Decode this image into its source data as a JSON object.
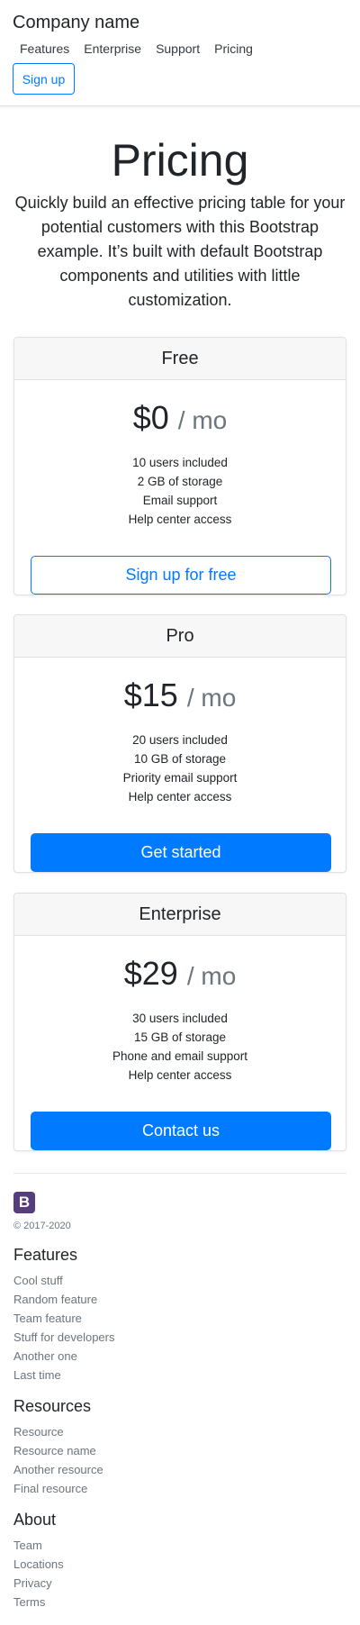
{
  "header": {
    "brand": "Company name",
    "nav": [
      "Features",
      "Enterprise",
      "Support",
      "Pricing"
    ],
    "signup_label": "Sign up"
  },
  "hero": {
    "title": "Pricing",
    "lead": "Quickly build an effective pricing table for your potential customers with this Bootstrap example. It’s built with default Bootstrap components and utilities with little customization."
  },
  "plans": [
    {
      "name": "Free",
      "price": "$0",
      "period": "/ mo",
      "features": [
        "10 users included",
        "2 GB of storage",
        "Email support",
        "Help center access"
      ],
      "button": "Sign up for free"
    },
    {
      "name": "Pro",
      "price": "$15",
      "period": "/ mo",
      "features": [
        "20 users included",
        "10 GB of storage",
        "Priority email support",
        "Help center access"
      ],
      "button": "Get started"
    },
    {
      "name": "Enterprise",
      "price": "$29",
      "period": "/ mo",
      "features": [
        "30 users included",
        "15 GB of storage",
        "Phone and email support",
        "Help center access"
      ],
      "button": "Contact us"
    }
  ],
  "footer": {
    "logo_letter": "B",
    "copyright": "© 2017-2020",
    "sections": [
      {
        "title": "Features",
        "links": [
          "Cool stuff",
          "Random feature",
          "Team feature",
          "Stuff for developers",
          "Another one",
          "Last time"
        ]
      },
      {
        "title": "Resources",
        "links": [
          "Resource",
          "Resource name",
          "Another resource",
          "Final resource"
        ]
      },
      {
        "title": "About",
        "links": [
          "Team",
          "Locations",
          "Privacy",
          "Terms"
        ]
      }
    ]
  },
  "colors": {
    "primary": "#007bff",
    "text": "#212529",
    "muted": "#6c757d",
    "card_header_bg": "#f7f7f7",
    "bootstrap_logo": "#563d7c"
  }
}
